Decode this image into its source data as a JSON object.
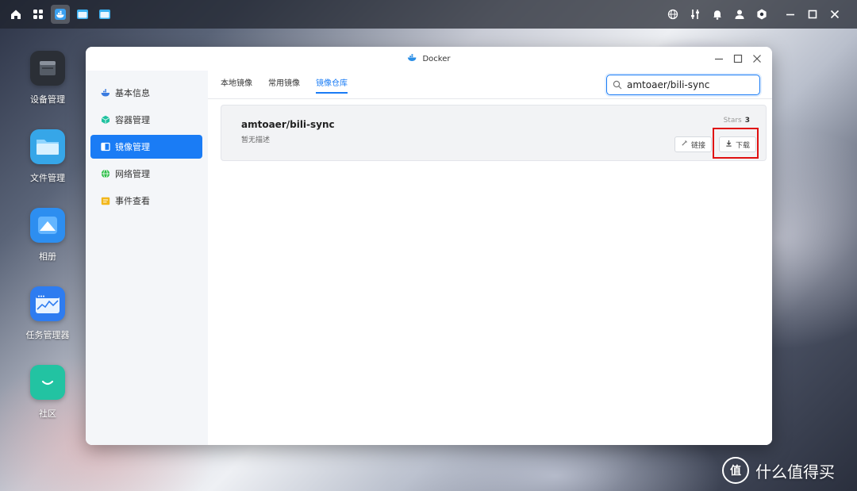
{
  "topbar": {
    "left_icons": [
      "home-icon",
      "apps-grid-icon",
      "docker-whale-icon",
      "folder-window-icon",
      "folder-window-icon-2"
    ],
    "right_icons": [
      "globe-icon",
      "sliders-icon",
      "bell-icon",
      "user-icon",
      "settings-icon",
      "minimize-icon",
      "maximize-icon",
      "close-icon"
    ]
  },
  "desktop": {
    "icons": [
      {
        "label": "设备管理",
        "icon": "device-box-icon",
        "color": "#2b2f36"
      },
      {
        "label": "文件管理",
        "icon": "folder-icon",
        "color": "#36a6e8"
      },
      {
        "label": "相册",
        "icon": "photo-mountain-icon",
        "color": "#2d8ef0"
      },
      {
        "label": "任务管理器",
        "icon": "monitor-chart-icon",
        "color": "#2e7cf0"
      },
      {
        "label": "社区",
        "icon": "chat-smile-icon",
        "color": "#22c3a2"
      }
    ]
  },
  "window": {
    "title": "Docker",
    "colors": {
      "accent": "#1a7cf5",
      "highlight_box": "#e01010"
    },
    "sidebar": {
      "items": [
        {
          "label": "基本信息",
          "icon": "whale-icon",
          "color": "#3a7be0",
          "active": false
        },
        {
          "label": "容器管理",
          "icon": "cube-icon",
          "color": "#1fc2a0",
          "active": false
        },
        {
          "label": "镜像管理",
          "icon": "image-book-icon",
          "color": "#ffffff",
          "active": true
        },
        {
          "label": "网络管理",
          "icon": "globe-green-icon",
          "color": "#2fbf4a",
          "active": false
        },
        {
          "label": "事件查看",
          "icon": "event-list-icon",
          "color": "#f2b71c",
          "active": false
        }
      ]
    },
    "tabs": [
      {
        "label": "本地镜像",
        "active": false
      },
      {
        "label": "常用镜像",
        "active": false
      },
      {
        "label": "镜像仓库",
        "active": true
      }
    ],
    "search": {
      "value": "amtoaer/bili-sync",
      "placeholder": ""
    },
    "result": {
      "name": "amtoaer/bili-sync",
      "description": "暂无描述",
      "stars_label": "Stars",
      "stars_value": "3",
      "link_label": "链接",
      "download_label": "下载"
    }
  },
  "watermark": {
    "text": "什么值得买",
    "logo": "值"
  }
}
